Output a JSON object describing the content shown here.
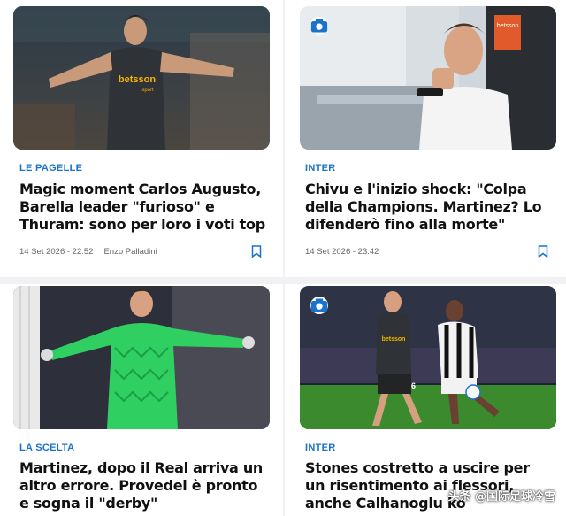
{
  "cards": [
    {
      "category": "LE PAGELLE",
      "title": "Magic moment Carlos Augusto, Barella leader \"furioso\" e Thuram: sono per loro i voti top",
      "date": "14 Set 2026 - 22:52",
      "author": "Enzo Palladini",
      "image_icon": "none",
      "bookmark": "bookmark-icon"
    },
    {
      "category": "INTER",
      "title": "Chivu e l'inizio shock: \"Colpa della Champions. Martinez? Lo difenderò fino alla morte\"",
      "date": "14 Set 2026 - 23:42",
      "author": "",
      "image_icon": "camera-icon",
      "bookmark": "bookmark-icon"
    },
    {
      "category": "LA SCELTA",
      "title": "Martinez, dopo il Real arriva un altro errore. Provedel è pronto e sogna il \"derby\"",
      "image_icon": "none"
    },
    {
      "category": "INTER",
      "title": "Stones costretto a uscire per un risentimento ai flessori, anche Calhanoglu ko",
      "image_icon": "camera-icon"
    }
  ],
  "photo_text": {
    "sponsor1": "betsson",
    "sponsor1_sub": "sport",
    "sponsor2": "betsson",
    "jersey_number": "6"
  },
  "watermark": "头条 @国际足球冷雪",
  "colors": {
    "category": "#1a73c9",
    "title": "#111111",
    "meta": "#666666",
    "background": "#f1f1f3"
  }
}
